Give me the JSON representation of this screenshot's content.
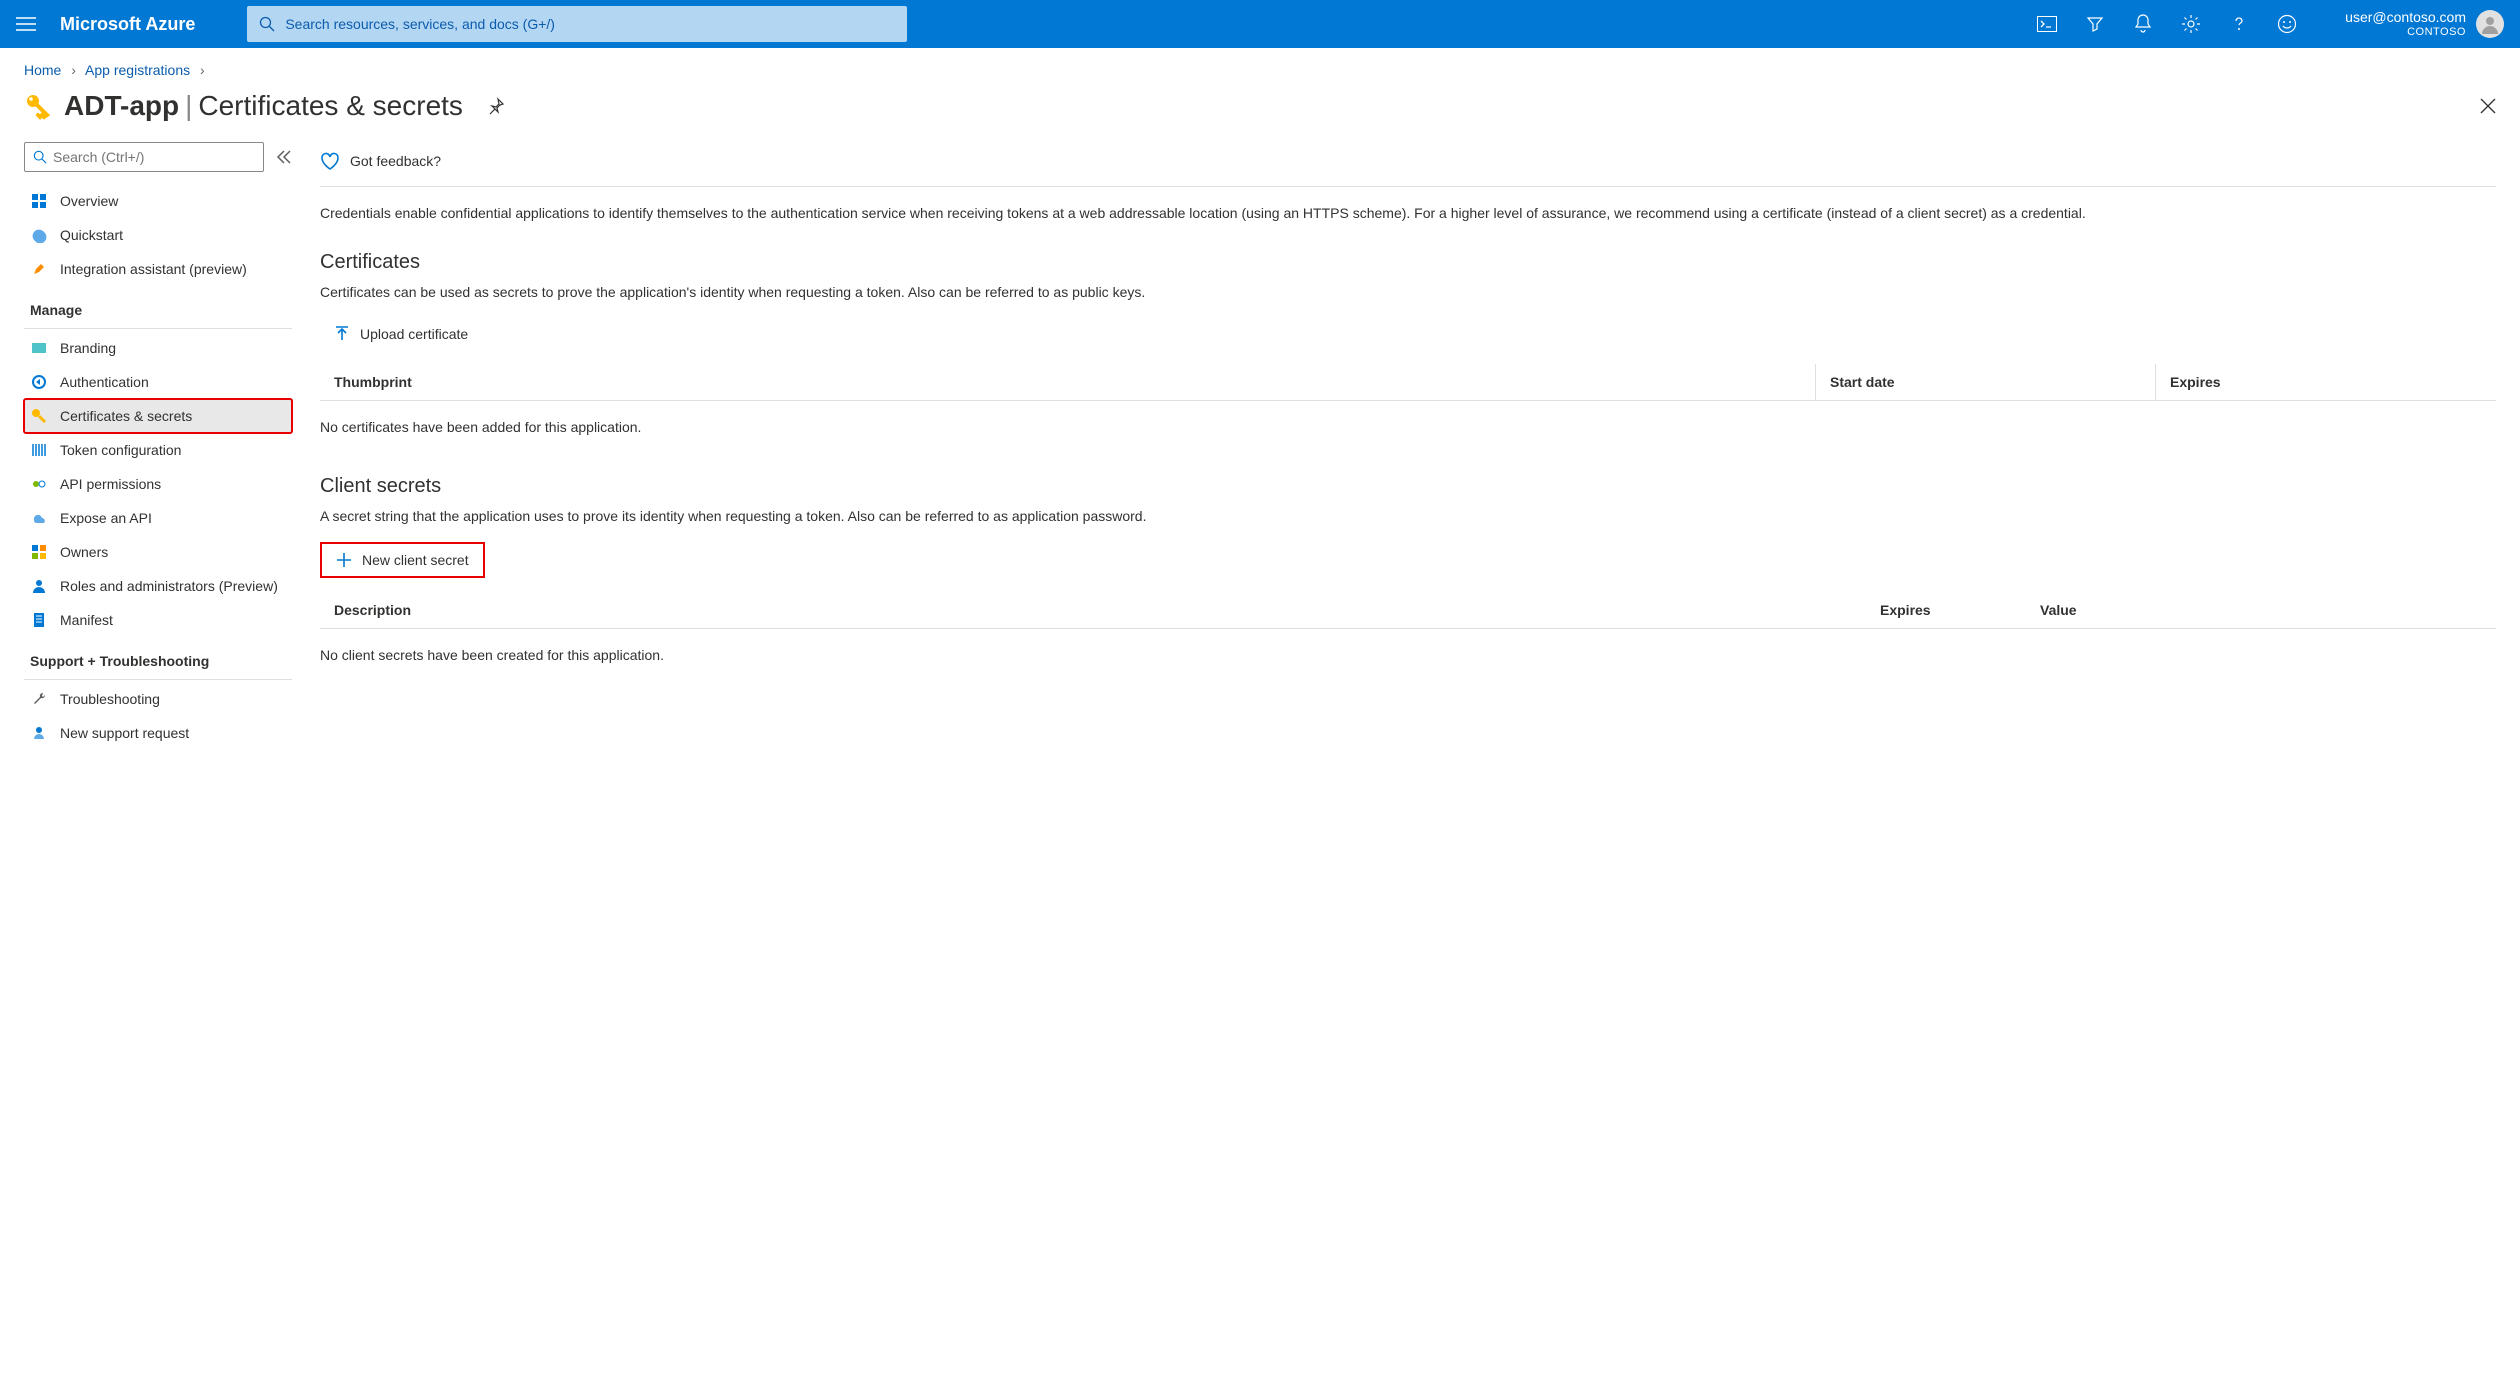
{
  "topbar": {
    "brand": "Microsoft Azure",
    "search_placeholder": "Search resources, services, and docs (G+/)",
    "user_email": "user@contoso.com",
    "user_org": "CONTOSO"
  },
  "breadcrumb": {
    "home": "Home",
    "app_reg": "App registrations"
  },
  "title": {
    "app_name": "ADT-app",
    "page": "Certificates & secrets"
  },
  "sidebar": {
    "search_placeholder": "Search (Ctrl+/)",
    "overview": "Overview",
    "quickstart": "Quickstart",
    "integration": "Integration assistant (preview)",
    "manage_section": "Manage",
    "branding": "Branding",
    "authentication": "Authentication",
    "certs": "Certificates & secrets",
    "token": "Token configuration",
    "api_perm": "API permissions",
    "expose": "Expose an API",
    "owners": "Owners",
    "roles": "Roles and administrators (Preview)",
    "manifest": "Manifest",
    "support_section": "Support + Troubleshooting",
    "troubleshooting": "Troubleshooting",
    "new_support": "New support request"
  },
  "main": {
    "feedback": "Got feedback?",
    "intro": "Credentials enable confidential applications to identify themselves to the authentication service when receiving tokens at a web addressable location (using an HTTPS scheme). For a higher level of assurance, we recommend using a certificate (instead of a client secret) as a credential.",
    "certs_title": "Certificates",
    "certs_desc": "Certificates can be used as secrets to prove the application's identity when requesting a token. Also can be referred to as public keys.",
    "upload_cert": "Upload certificate",
    "certs_cols": {
      "thumb": "Thumbprint",
      "start": "Start date",
      "expires": "Expires"
    },
    "certs_empty": "No certificates have been added for this application.",
    "secrets_title": "Client secrets",
    "secrets_desc": "A secret string that the application uses to prove its identity when requesting a token. Also can be referred to as application password.",
    "new_secret": "New client secret",
    "secrets_cols": {
      "desc": "Description",
      "expires": "Expires",
      "value": "Value"
    },
    "secrets_empty": "No client secrets have been created for this application."
  }
}
